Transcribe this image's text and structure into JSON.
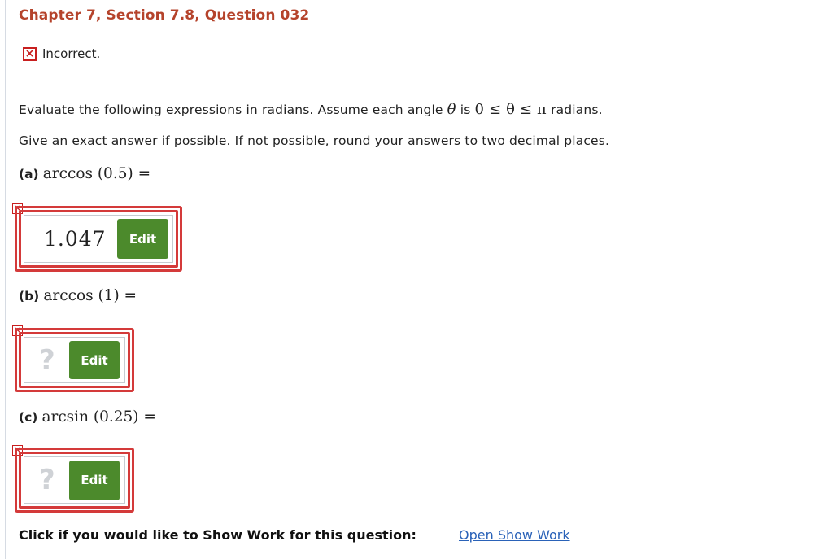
{
  "header": {
    "title": "Chapter 7, Section 7.8, Question 032"
  },
  "status": {
    "icon": "x-box-icon",
    "text": "Incorrect.",
    "color": "#c81f1f"
  },
  "instructions": {
    "line1_pre": "Evaluate the following expressions in radians. Assume each angle ",
    "theta": "θ",
    "line1_mid": " is ",
    "range": "0 ≤ θ ≤ π",
    "line1_post": " radians.",
    "line2": "Give an exact answer if possible. If not possible, round your answers to two decimal places."
  },
  "parts": [
    {
      "label": "(a)",
      "expression": "arccos (0.5) =",
      "answer": "1.047",
      "edit_label": "Edit",
      "status": "incorrect"
    },
    {
      "label": "(b)",
      "expression": "arccos (1) =",
      "answer": "?",
      "edit_label": "Edit",
      "status": "incorrect"
    },
    {
      "label": "(c)",
      "expression": "arcsin (0.25) =",
      "answer": "?",
      "edit_label": "Edit",
      "status": "incorrect"
    }
  ],
  "footer": {
    "show_work_prompt": "Click if you would like to Show Work for this question:",
    "show_work_link": "Open Show Work"
  },
  "colors": {
    "title": "#b5432b",
    "error": "#d43a3a",
    "edit_button": "#4c8a2c",
    "link": "#2a62b8"
  }
}
